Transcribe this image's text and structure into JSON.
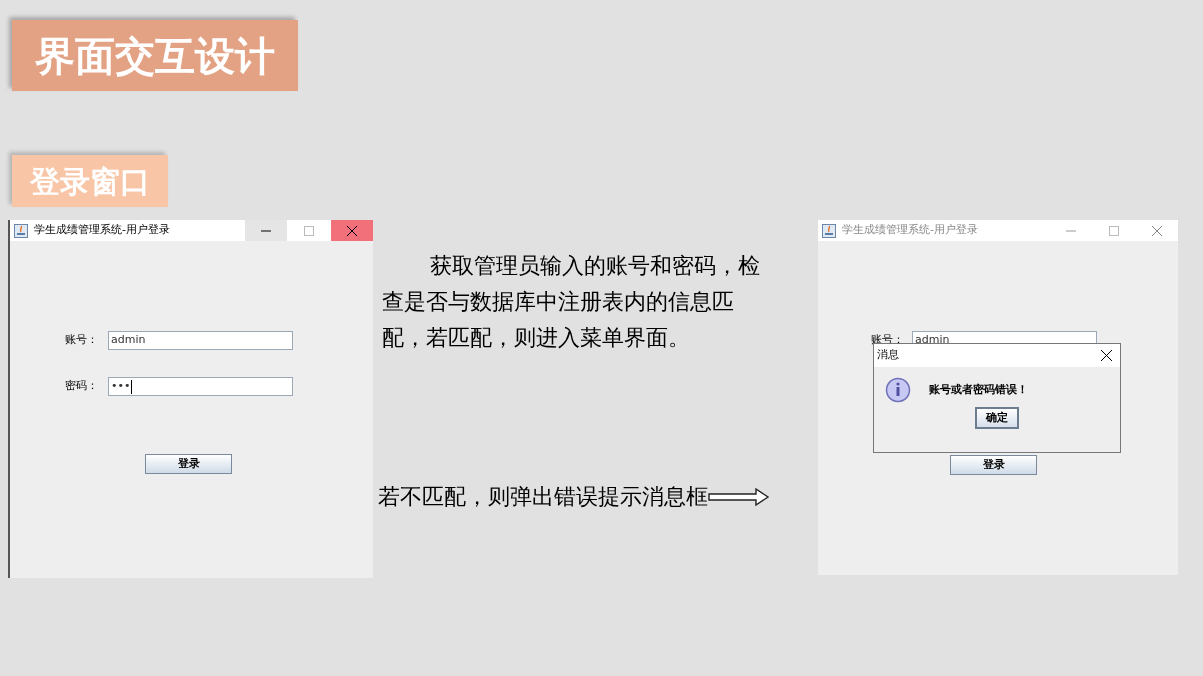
{
  "slide": {
    "title": "界面交互设计",
    "section": "登录窗口"
  },
  "login_window": {
    "title": "学生成绩管理系统-用户登录",
    "active": true,
    "fields": [
      {
        "label": "账号：",
        "value": "admin",
        "kind": "text"
      },
      {
        "label": "密码：",
        "value": "•••",
        "kind": "password"
      }
    ],
    "button": "登录"
  },
  "descriptions": [
    "获取管理员输入的账号和密码，检查是否与数据库中注册表内的信息匹配，若匹配，则进入菜单界面。",
    "若不匹配，则弹出错误提示消息框"
  ],
  "error_window": {
    "title": "学生成绩管理系统-用户登录",
    "active": false,
    "account_label": "账号：",
    "account_value": "admin",
    "button": "登录",
    "dialog": {
      "title": "消息",
      "message": "账号或者密码错误！",
      "button": "确定"
    }
  }
}
